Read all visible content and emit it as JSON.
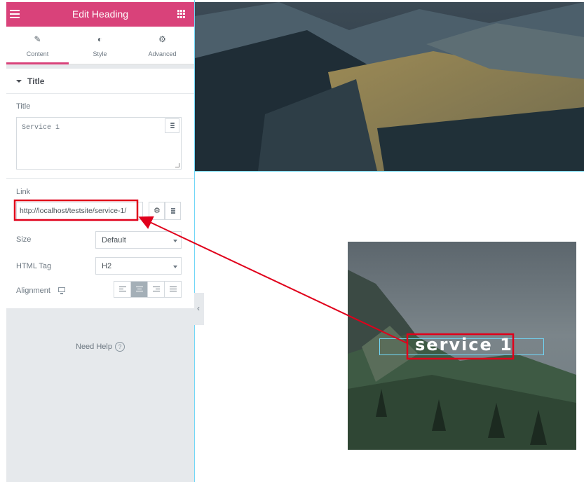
{
  "header": {
    "title": "Edit Heading"
  },
  "tabs": [
    {
      "label": "Content"
    },
    {
      "label": "Style"
    },
    {
      "label": "Advanced"
    }
  ],
  "section": {
    "title": "Title"
  },
  "title_control": {
    "label": "Title",
    "value": "Service 1"
  },
  "link_control": {
    "label": "Link",
    "value": "http://localhost/testsite/service-1/"
  },
  "size_control": {
    "label": "Size",
    "value": "Default"
  },
  "tag_control": {
    "label": "HTML Tag",
    "value": "H2"
  },
  "alignment_control": {
    "label": "Alignment",
    "active_index": 1
  },
  "help": {
    "label": "Need Help",
    "icon": "?"
  },
  "preview": {
    "heading": "service 1"
  },
  "colors": {
    "accent": "#d9427a",
    "highlight": "#e0001b",
    "selection": "#71d7f7"
  },
  "icons": [
    "hamburger-icon",
    "apps-grid-icon",
    "pencil-icon",
    "contrast-icon",
    "gear-icon",
    "database-icon",
    "desktop-icon",
    "question-icon",
    "chevron-left-icon"
  ]
}
